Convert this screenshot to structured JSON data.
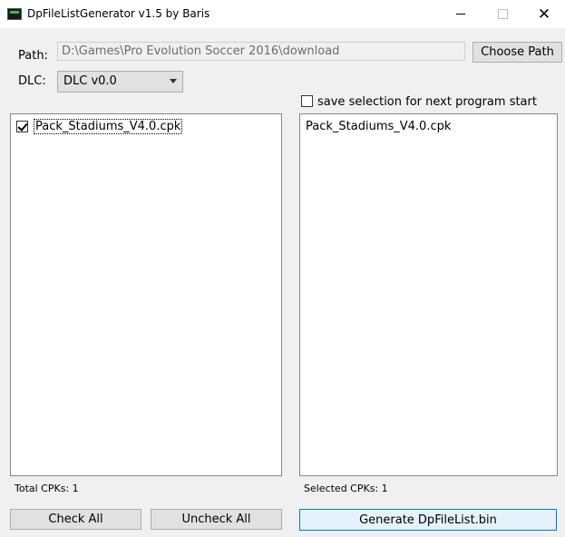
{
  "window": {
    "title": "DpFileListGenerator v1.5 by Baris",
    "minimize_icon": "minimize-icon",
    "maximize_icon": "maximize-icon",
    "close_icon": "close-icon",
    "close_glyph": "✕"
  },
  "path": {
    "label": "Path:",
    "value": "D:\\Games\\Pro Evolution Soccer 2016\\download",
    "choose_label": "Choose Path"
  },
  "dlc": {
    "label": "DLC:",
    "selected": "DLC v0.0"
  },
  "save_selection": {
    "label": "save selection for next program start",
    "checked": false
  },
  "available_list": {
    "items": [
      {
        "label": "Pack_Stadiums_V4.0.cpk",
        "checked": true
      }
    ],
    "total_label": "Total CPKs: 1"
  },
  "selected_list": {
    "items": [
      {
        "label": "Pack_Stadiums_V4.0.cpk"
      }
    ],
    "selected_label": "Selected CPKs: 1"
  },
  "buttons": {
    "check_all": "Check All",
    "uncheck_all": "Uncheck All",
    "generate": "Generate DpFileList.bin"
  },
  "colors": {
    "window_bg": "#f0f0f0",
    "accent_border": "#0078d7",
    "accent_fill": "#e5f1fb"
  }
}
